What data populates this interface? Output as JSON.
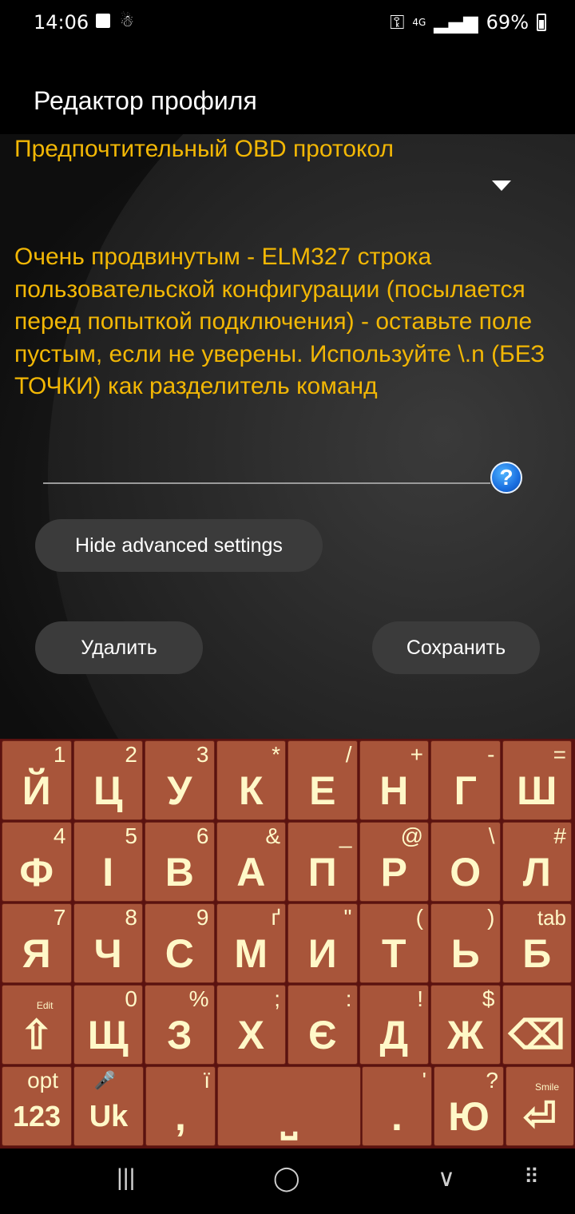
{
  "status_bar": {
    "time": "14:06",
    "network": "4G",
    "battery": "69%"
  },
  "app_bar": {
    "title": "Редактор профиля"
  },
  "form": {
    "protocol_label": "Предпочтительный OBD протокол",
    "advanced_label": "Очень продвинутым - ELM327 строка пользовательской конфигурации (посылается перед попыткой подключения) - оставьте поле пустым, если не уверены. Используйте \\.n (БЕЗ ТОЧКИ) как разделитель команд",
    "help_glyph": "?",
    "hide_advanced_button": "Hide advanced settings",
    "delete_button": "Удалить",
    "save_button": "Сохранить"
  },
  "keyboard": {
    "rows": [
      [
        {
          "main": "Й",
          "sup": "1"
        },
        {
          "main": "Ц",
          "sup": "2"
        },
        {
          "main": "У",
          "sup": "3"
        },
        {
          "main": "К",
          "sup": "*"
        },
        {
          "main": "Е",
          "sup": "/"
        },
        {
          "main": "Н",
          "sup": "+"
        },
        {
          "main": "Г",
          "sup": "-"
        },
        {
          "main": "Ш",
          "sup": "="
        }
      ],
      [
        {
          "main": "Ф",
          "sup": "4"
        },
        {
          "main": "І",
          "sup": "5"
        },
        {
          "main": "В",
          "sup": "6"
        },
        {
          "main": "А",
          "sup": "&"
        },
        {
          "main": "П",
          "sup": "_"
        },
        {
          "main": "Р",
          "sup": "@"
        },
        {
          "main": "О",
          "sup": "\\"
        },
        {
          "main": "Л",
          "sup": "#"
        }
      ],
      [
        {
          "main": "Я",
          "sup": "7"
        },
        {
          "main": "Ч",
          "sup": "8"
        },
        {
          "main": "С",
          "sup": "9"
        },
        {
          "main": "М",
          "sup": "ґ"
        },
        {
          "main": "И",
          "sup": "\""
        },
        {
          "main": "Т",
          "sup": "("
        },
        {
          "main": "Ь",
          "sup": ")"
        },
        {
          "main": "Б",
          "sup": "tab"
        }
      ],
      [
        {
          "main": "⇧",
          "sup": "Edit"
        },
        {
          "main": "Щ",
          "sup": "0"
        },
        {
          "main": "З",
          "sup": "%"
        },
        {
          "main": "Х",
          "sup": ";"
        },
        {
          "main": "Є",
          "sup": ":"
        },
        {
          "main": "Д",
          "sup": "!"
        },
        {
          "main": "Ж",
          "sup": "$"
        },
        {
          "main": "⌫",
          "sup": ""
        }
      ]
    ],
    "bottom_row": {
      "opt": {
        "main": "123",
        "sup": "opt"
      },
      "lang": {
        "main": "Uk",
        "sup": "🎤"
      },
      "comma": {
        "main": ",",
        "sup": "ї"
      },
      "space": {
        "main": "⎵",
        "sup": ""
      },
      "period": {
        "main": ".",
        "sup": "'"
      },
      "yu": {
        "main": "Ю",
        "sup": "?"
      },
      "enter": {
        "main": "⏎",
        "sup": "Smile"
      }
    }
  },
  "nav_bar": {
    "recents": "|||",
    "home": "◯",
    "back": "∨",
    "keyboard_toggle": "⠿"
  }
}
